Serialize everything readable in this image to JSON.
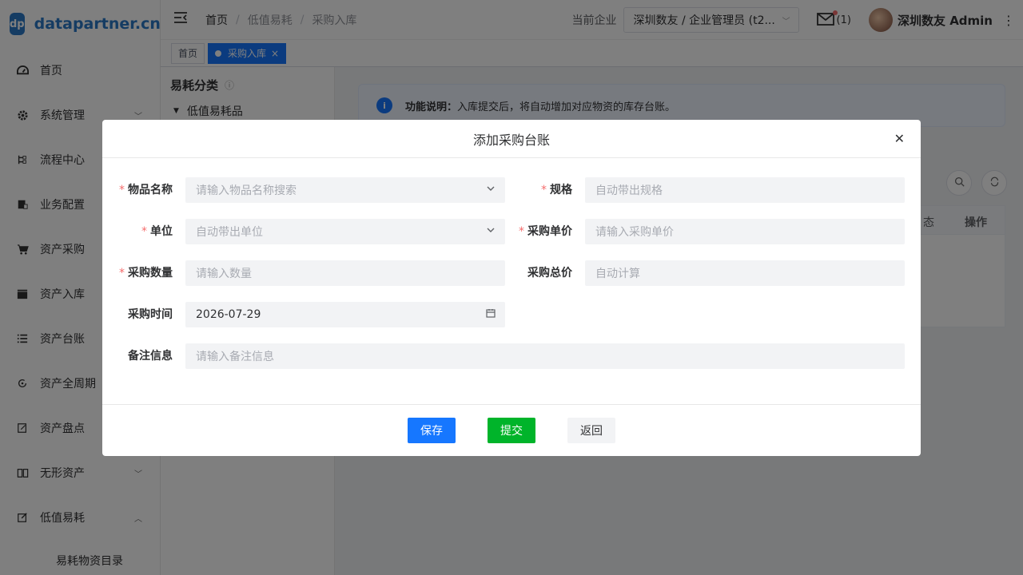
{
  "app": {
    "logo_badge": "dp",
    "logo_text": "datapartner.cn"
  },
  "sidebar": {
    "items": [
      {
        "label": "首页",
        "icon": "dashboard-icon"
      },
      {
        "label": "系统管理",
        "icon": "gear-icon",
        "chevron": "down"
      },
      {
        "label": "流程中心",
        "icon": "flow-icon"
      },
      {
        "label": "业务配置",
        "icon": "config-icon"
      },
      {
        "label": "资产采购",
        "icon": "cart-icon"
      },
      {
        "label": "资产入库",
        "icon": "clapper-icon"
      },
      {
        "label": "资产台账",
        "icon": "list-icon"
      },
      {
        "label": "资产全周期",
        "icon": "cycle-icon"
      },
      {
        "label": "资产盘点",
        "icon": "edit-icon"
      },
      {
        "label": "无形资产",
        "icon": "book-icon",
        "chevron": "down"
      },
      {
        "label": "低值易耗",
        "icon": "note-edit-icon",
        "chevron": "up"
      }
    ],
    "sub_item": "易耗物资目录"
  },
  "header": {
    "breadcrumb": [
      "首页",
      "低值易耗",
      "采购入库"
    ],
    "current_enterprise_label": "当前企业",
    "enterprise_value": "深圳数友 / 企业管理员 (t2...",
    "mail_count": "(1)",
    "user_name": "深圳数友 Admin"
  },
  "tags": [
    {
      "label": "首页",
      "active": false
    },
    {
      "label": "采购入库",
      "active": true
    }
  ],
  "background": {
    "tree_title": "易耗分类",
    "tree_node": "低值易耗品",
    "notice_title": "功能说明：",
    "notice_text": "入库提交后，将自动增加对应物资的库存台账。",
    "table_head_status": "态",
    "table_head_ops": "操作"
  },
  "dialog": {
    "title": "添加采购台账",
    "fields": {
      "item_name": {
        "label": "物品名称",
        "required": true,
        "placeholder": "请输入物品名称搜索"
      },
      "spec": {
        "label": "规格",
        "required": true,
        "placeholder": "自动带出规格"
      },
      "unit": {
        "label": "单位",
        "required": true,
        "placeholder": "自动带出单位"
      },
      "unit_price": {
        "label": "采购单价",
        "required": true,
        "placeholder": "请输入采购单价"
      },
      "quantity": {
        "label": "采购数量",
        "required": true,
        "placeholder": "请输入数量"
      },
      "total_price": {
        "label": "采购总价",
        "required": false,
        "placeholder": "自动计算"
      },
      "purchase_time": {
        "label": "采购时间",
        "required": false,
        "value": "2026-07-29"
      },
      "remarks": {
        "label": "备注信息",
        "required": false,
        "placeholder": "请输入备注信息"
      }
    },
    "buttons": {
      "save": "保存",
      "submit": "提交",
      "back": "返回"
    }
  },
  "colors": {
    "primary": "#1677ff",
    "success": "#00b42a",
    "required": "#f56c6c"
  }
}
